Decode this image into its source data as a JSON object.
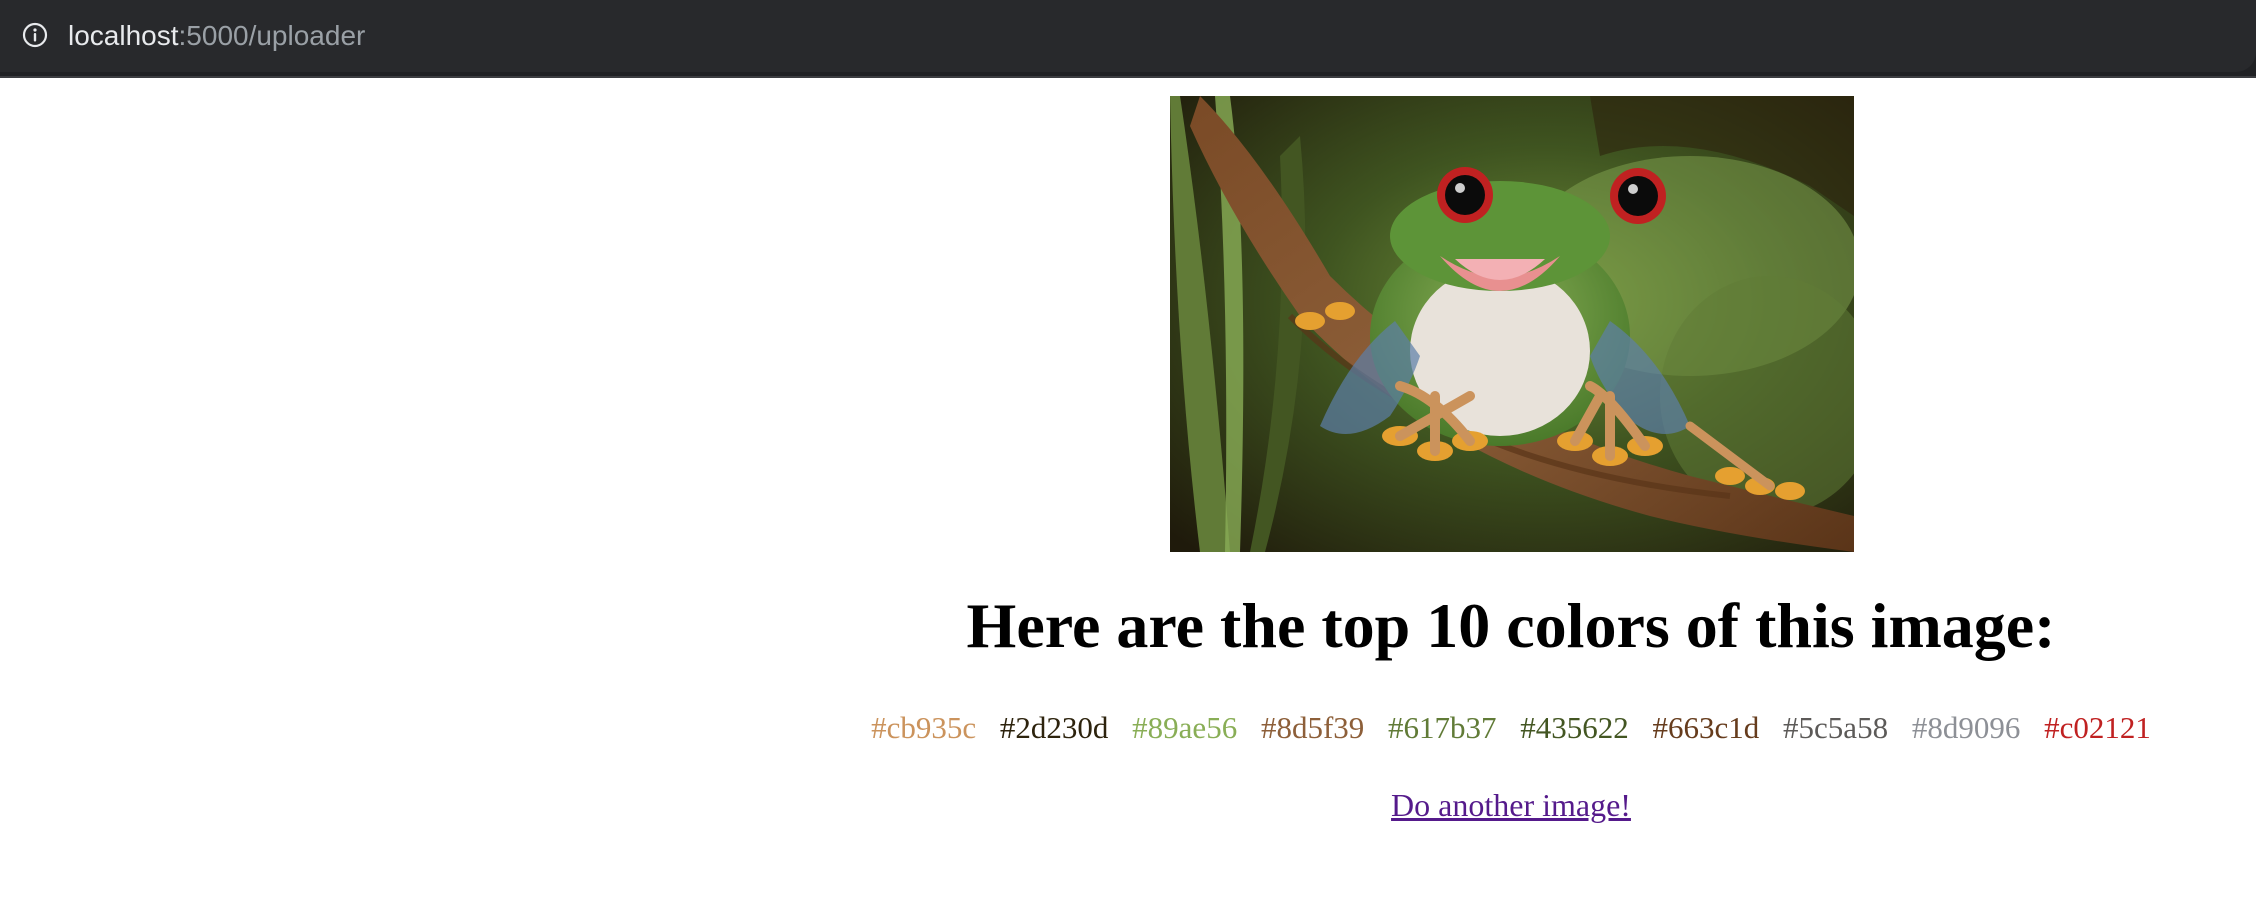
{
  "browser": {
    "url_host": "localhost",
    "url_rest": ":5000/uploader"
  },
  "main": {
    "image_alt": "Red-eyed tree frog",
    "heading": "Here are the top 10 colors of this image:",
    "colors": [
      {
        "label": "#cb935c",
        "color": "#cb935c"
      },
      {
        "label": "#2d230d",
        "color": "#2d230d"
      },
      {
        "label": "#89ae56",
        "color": "#89ae56"
      },
      {
        "label": "#8d5f39",
        "color": "#8d5f39"
      },
      {
        "label": "#617b37",
        "color": "#617b37"
      },
      {
        "label": "#435622",
        "color": "#435622"
      },
      {
        "label": "#663c1d",
        "color": "#663c1d"
      },
      {
        "label": "#5c5a58",
        "color": "#5c5a58"
      },
      {
        "label": "#8d9096",
        "color": "#8d9096"
      },
      {
        "label": "#c02121",
        "color": "#c02121"
      }
    ],
    "again_link": "Do another image!"
  }
}
